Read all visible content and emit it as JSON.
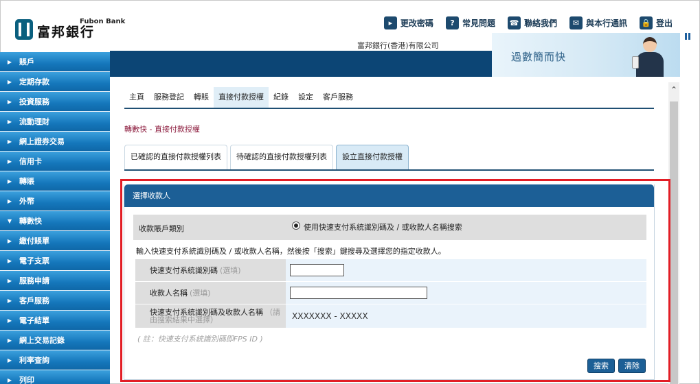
{
  "brand": {
    "name_en": "Fubon Bank",
    "name_zh": "富邦銀行",
    "company": "富邦銀行(香港)有限公司"
  },
  "toplinks": [
    {
      "label": "更改密碼",
      "icon": "play-icon",
      "glyph": "▸"
    },
    {
      "label": "常見問題",
      "icon": "question-icon",
      "glyph": "?"
    },
    {
      "label": "聯絡我們",
      "icon": "phone-icon",
      "glyph": "☎"
    },
    {
      "label": "與本行通訊",
      "icon": "mail-icon",
      "glyph": "✉"
    },
    {
      "label": "登出",
      "icon": "lock-icon",
      "glyph": "🔒"
    }
  ],
  "banner": {
    "text": "過數簡而快"
  },
  "sidebar": {
    "items": [
      {
        "label": "賬戶",
        "arrow": "▶"
      },
      {
        "label": "定期存款",
        "arrow": "▶"
      },
      {
        "label": "投資服務",
        "arrow": "▶"
      },
      {
        "label": "流動理財",
        "arrow": "▶"
      },
      {
        "label": "網上證券交易",
        "arrow": "▶"
      },
      {
        "label": "信用卡",
        "arrow": "▶"
      },
      {
        "label": "轉賬",
        "arrow": "▶"
      },
      {
        "label": "外幣",
        "arrow": "▶"
      },
      {
        "label": "轉數快",
        "arrow": "▼"
      },
      {
        "label": "繳付賬單",
        "arrow": "▶"
      },
      {
        "label": "電子支票",
        "arrow": "▶"
      },
      {
        "label": "服務申請",
        "arrow": "▶"
      },
      {
        "label": "客戶服務",
        "arrow": "▶"
      },
      {
        "label": "電子結單",
        "arrow": "▶"
      },
      {
        "label": "網上交易記錄",
        "arrow": "▶"
      },
      {
        "label": "利率查詢",
        "arrow": "▶"
      },
      {
        "label": "列印",
        "arrow": "▶"
      }
    ]
  },
  "topnav": {
    "items": [
      "主頁",
      "服務登記",
      "轉賬",
      "直接付款授權",
      "紀錄",
      "設定",
      "客戶服務"
    ],
    "active_index": 3
  },
  "breadcrumb": "轉數快 - 直接付款授權",
  "subtabs": {
    "items": [
      "已確認的直接付款授權列表",
      "待確認的直接付款授權列表",
      "設立直接付款授權"
    ],
    "active_index": 2
  },
  "panel": {
    "title": "選擇收款人",
    "account_type_label": "收款賬戶類別",
    "radio_option": "使用快速支付系統識別碼及 / 或收款人名稱搜索",
    "instruction": "輸入快速支付系統識別碼及 / 或收款人名稱，然後按「搜索」鍵搜尋及選擇您的指定收款人。",
    "fps_id_label": "快速支付系統識別碼",
    "fps_id_optional": "(選填)",
    "fps_id_value": "",
    "payee_name_label": "收款人名稱",
    "payee_name_optional": "(選填)",
    "payee_name_value": "",
    "result_label": "快速支付系統識別碼及收款人名稱",
    "result_hint": "（請由搜索結果中選擇）",
    "result_value": "XXXXXXX - XXXXX",
    "note": "( 註：快速支付系統識別碼即FPS ID )",
    "search_button": "搜索",
    "clear_button": "清除"
  }
}
